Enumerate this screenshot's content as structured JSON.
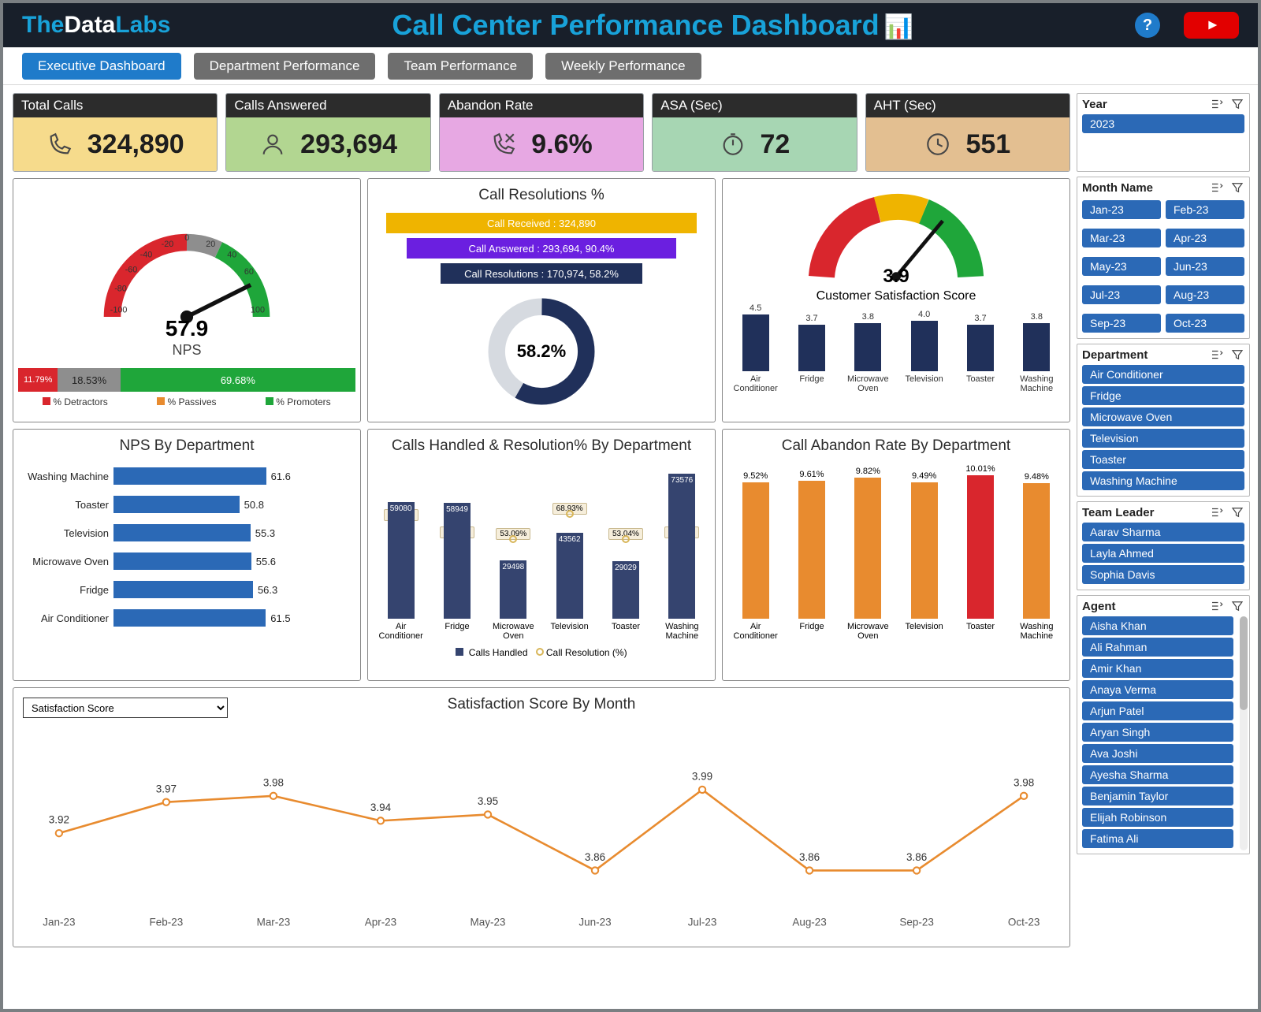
{
  "header": {
    "logo_pre": "The",
    "logo_mid": "Data",
    "logo_post": "Labs",
    "title": "Call Center Performance Dashboard"
  },
  "tabs": [
    "Executive Dashboard",
    "Department Performance",
    "Team Performance",
    "Weekly Performance"
  ],
  "kpi": {
    "totalCalls": {
      "label": "Total Calls",
      "value": "324,890"
    },
    "answered": {
      "label": "Calls Answered",
      "value": "293,694"
    },
    "abandon": {
      "label": "Abandon Rate",
      "value": "9.6%"
    },
    "asa": {
      "label": "ASA (Sec)",
      "value": "72"
    },
    "aht": {
      "label": "AHT (Sec)",
      "value": "551"
    }
  },
  "nps": {
    "value": "57.9",
    "label": "NPS",
    "detractors": "11.79%",
    "passives": "18.53%",
    "promoters": "69.68%",
    "legend_d": "% Detractors",
    "legend_p": "% Passives",
    "legend_pr": "% Promoters"
  },
  "resolutions": {
    "title": "Call Resolutions %",
    "bar1": "Call Received : 324,890",
    "bar2": "Call Answered : 293,694, 90.4%",
    "bar3": "Call Resolutions : 170,974, 58.2%",
    "donut": "58.2%"
  },
  "css": {
    "value": "3.9",
    "label": "Customer Satisfaction Score"
  },
  "npsDept": {
    "title": "NPS By Department"
  },
  "callsDept": {
    "title": "Calls Handled & Resolution% By Department",
    "leg1": "Calls Handled",
    "leg2": "Call Resolution (%)"
  },
  "abandonDept": {
    "title": "Call Abandon Rate By Department"
  },
  "satMonth": {
    "title": "Satisfaction Score By Month",
    "dropdown": "Satisfaction Score"
  },
  "slicers": {
    "year": {
      "title": "Year",
      "items": [
        "2023"
      ]
    },
    "month": {
      "title": "Month Name",
      "items": [
        "Jan-23",
        "Feb-23",
        "Mar-23",
        "Apr-23",
        "May-23",
        "Jun-23",
        "Jul-23",
        "Aug-23",
        "Sep-23",
        "Oct-23"
      ]
    },
    "dept": {
      "title": "Department",
      "items": [
        "Air Conditioner",
        "Fridge",
        "Microwave  Oven",
        "Television",
        "Toaster",
        "Washing Machine"
      ]
    },
    "leader": {
      "title": "Team Leader",
      "items": [
        "Aarav Sharma",
        "Layla Ahmed",
        "Sophia Davis"
      ]
    },
    "agent": {
      "title": "Agent",
      "items": [
        "Aisha Khan",
        "Ali Rahman",
        "Amir Khan",
        "Anaya Verma",
        "Arjun Patel",
        "Aryan Singh",
        "Ava Joshi",
        "Ayesha Sharma",
        "Benjamin Taylor",
        "Elijah Robinson",
        "Fatima Ali"
      ]
    }
  },
  "chart_data": [
    {
      "type": "gauge",
      "title": "NPS",
      "value": 57.9,
      "range": [
        -100,
        100
      ],
      "ticks": [
        -100,
        -80,
        -60,
        -40,
        -20,
        0,
        20,
        40,
        60,
        100
      ],
      "segments": [
        {
          "name": "% Detractors",
          "pct": 11.79,
          "color": "#d9262d"
        },
        {
          "name": "% Passives",
          "pct": 18.53,
          "color": "#8e8e8e"
        },
        {
          "name": "% Promoters",
          "pct": 69.68,
          "color": "#1fa63a"
        }
      ]
    },
    {
      "type": "funnel",
      "title": "Call Resolutions %",
      "steps": [
        {
          "label": "Call Received",
          "value": 324890
        },
        {
          "label": "Call Answered",
          "value": 293694,
          "pct": 90.4
        },
        {
          "label": "Call Resolutions",
          "value": 170974,
          "pct": 58.2
        }
      ]
    },
    {
      "type": "gauge",
      "title": "Customer Satisfaction Score",
      "value": 3.9,
      "range": [
        1,
        5
      ],
      "zones": [
        {
          "to": 2.5,
          "color": "#d9262d"
        },
        {
          "to": 3.5,
          "color": "#efb400"
        },
        {
          "to": 5,
          "color": "#1fa63a"
        }
      ]
    },
    {
      "type": "bar",
      "title": "Customer Satisfaction Score by Dept",
      "categories": [
        "Air Conditioner",
        "Fridge",
        "Microwave Oven",
        "Television",
        "Toaster",
        "Washing Machine"
      ],
      "values": [
        4.5,
        3.7,
        3.8,
        4.0,
        3.7,
        3.8
      ],
      "ylim": [
        0,
        5
      ]
    },
    {
      "type": "bar",
      "orientation": "h",
      "title": "NPS By Department",
      "categories": [
        "Washing Machine",
        "Toaster",
        "Television",
        "Microwave  Oven",
        "Fridge",
        "Air Conditioner"
      ],
      "values": [
        61.6,
        50.8,
        55.3,
        55.6,
        56.3,
        61.5
      ],
      "xlim": [
        0,
        70
      ]
    },
    {
      "type": "bar",
      "title": "Calls Handled & Resolution% By Department",
      "categories": [
        "Air Conditioner",
        "Fridge",
        "Microwave Oven",
        "Television",
        "Toaster",
        "Washing Machine"
      ],
      "series": [
        {
          "name": "Calls Handled",
          "values": [
            59080,
            58949,
            29498,
            43562,
            29029,
            73576
          ]
        },
        {
          "name": "Call Resolution (%)",
          "values": [
            64.8,
            54.05,
            53.09,
            68.93,
            53.04,
            54.02
          ]
        }
      ],
      "ylim": [
        0,
        80000
      ]
    },
    {
      "type": "bar",
      "title": "Call Abandon Rate By Department",
      "categories": [
        "Air Conditioner",
        "Fridge",
        "Microwave Oven",
        "Television",
        "Toaster",
        "Washing Machine"
      ],
      "values": [
        9.52,
        9.61,
        9.82,
        9.49,
        10.01,
        9.48
      ],
      "ylim": [
        0,
        11
      ],
      "highlight_index": 4
    },
    {
      "type": "line",
      "title": "Satisfaction Score By Month",
      "x": [
        "Jan-23",
        "Feb-23",
        "Mar-23",
        "Apr-23",
        "May-23",
        "Jun-23",
        "Jul-23",
        "Aug-23",
        "Sep-23",
        "Oct-23"
      ],
      "values": [
        3.92,
        3.97,
        3.98,
        3.94,
        3.95,
        3.86,
        3.99,
        3.86,
        3.86,
        3.98
      ],
      "ylim": [
        3.8,
        4.05
      ]
    }
  ]
}
